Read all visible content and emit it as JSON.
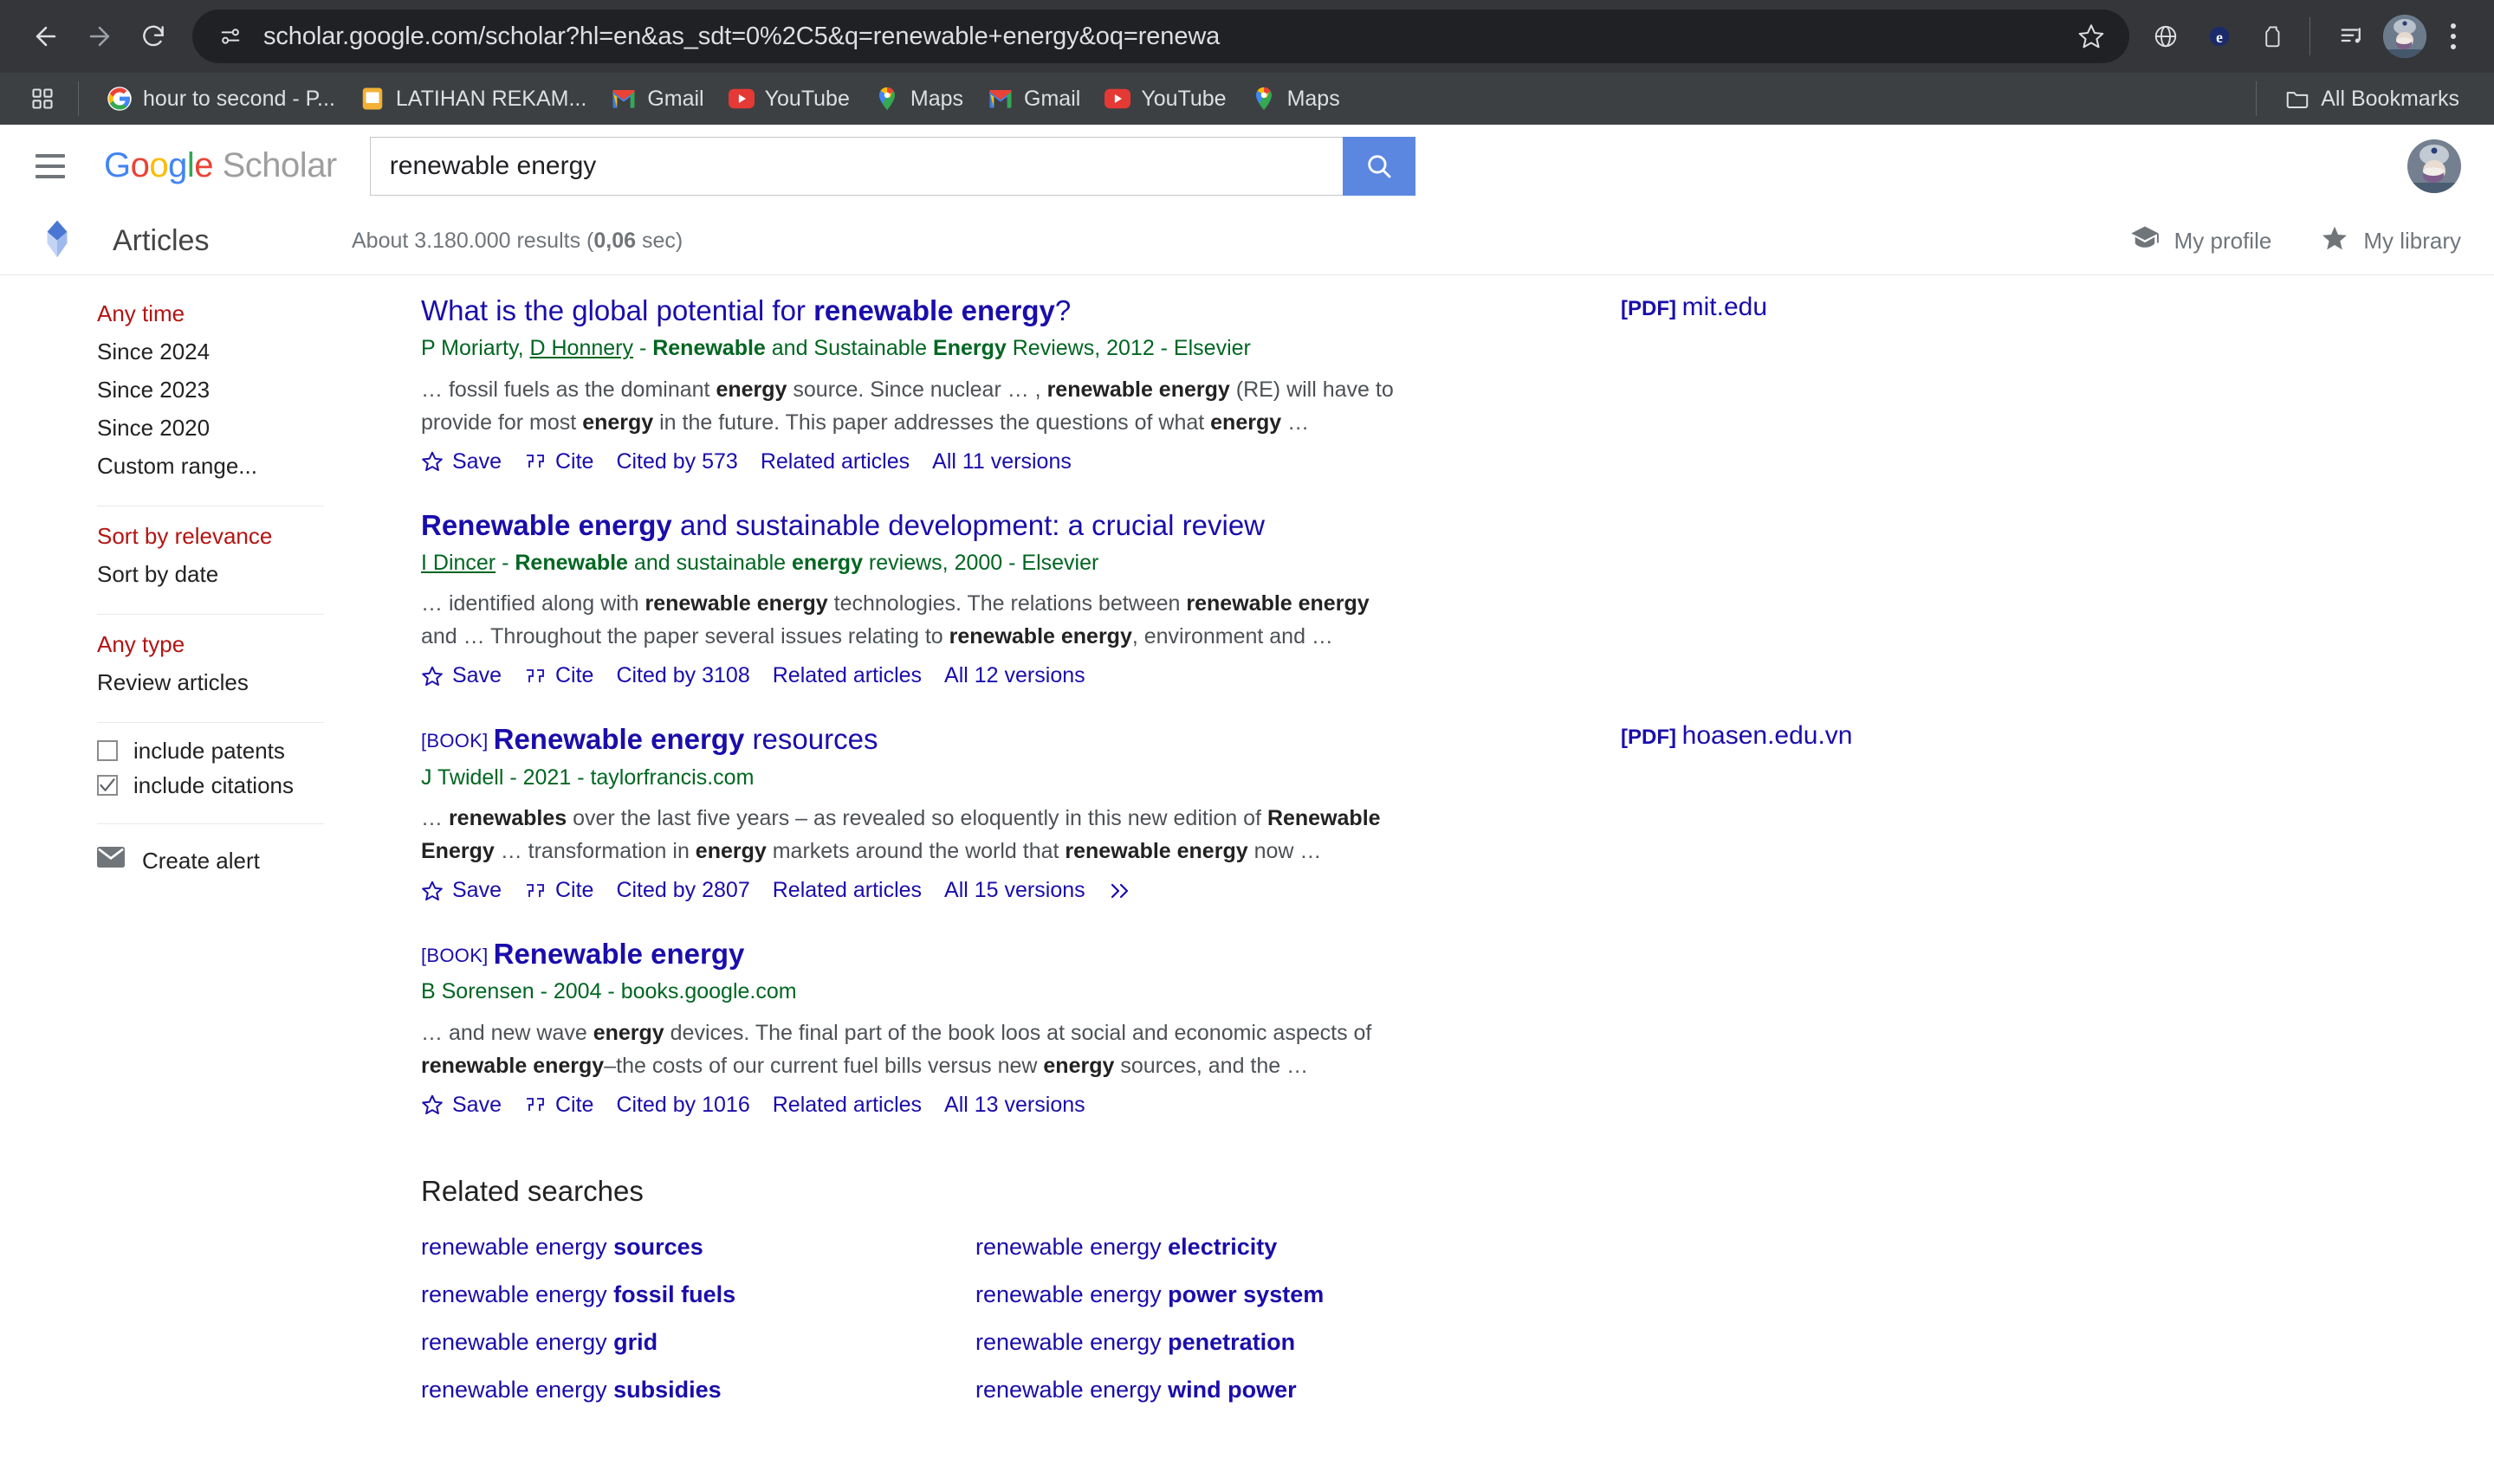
{
  "browser": {
    "url": "scholar.google.com/scholar?hl=en&as_sdt=0%2C5&q=renewable+energy&oq=renewa",
    "back_label": "Back",
    "forward_label": "Forward",
    "reload_label": "Reload",
    "site_info_label": "View site information",
    "bookmark_star_label": "Bookmark this tab",
    "toolbar_icons": [
      "globe-icon",
      "extension-puzzle-icon",
      "extension-icon",
      "reading-list-icon"
    ],
    "profile_label": "Profile",
    "menu_label": "Customize and control Google Chrome"
  },
  "bookmarks": {
    "apps_label": "Apps",
    "items": [
      {
        "label": "hour to second - P...",
        "icon": "google-favicon"
      },
      {
        "label": "LATIHAN REKAM...",
        "icon": "sheet-favicon"
      },
      {
        "label": "Gmail",
        "icon": "gmail-favicon"
      },
      {
        "label": "YouTube",
        "icon": "youtube-favicon"
      },
      {
        "label": "Maps",
        "icon": "maps-favicon"
      },
      {
        "label": "Gmail",
        "icon": "gmail-favicon"
      },
      {
        "label": "YouTube",
        "icon": "youtube-favicon"
      },
      {
        "label": "Maps",
        "icon": "maps-favicon"
      }
    ],
    "all_bookmarks_label": "All Bookmarks"
  },
  "scholar_header": {
    "menu_label": "Menu",
    "logo": {
      "g1": "G",
      "o1": "o",
      "o2": "o",
      "g2": "g",
      "l1": "l",
      "e1": "e",
      "scholar": " Scholar"
    },
    "search_value": "renewable energy",
    "search_placeholder": "Search",
    "search_button_label": "Search",
    "avatar_label": "Google Account"
  },
  "sub_header": {
    "section_icon": "scholar-articles-icon",
    "section_label": "Articles",
    "results_text_prefix": "About 3.180.000 results (",
    "results_time": "0,06",
    "results_text_suffix": " sec)",
    "my_profile_label": "My profile",
    "my_library_label": "My library"
  },
  "sidebar": {
    "time_group": [
      {
        "label": "Any time",
        "active": true
      },
      {
        "label": "Since 2024",
        "active": false
      },
      {
        "label": "Since 2023",
        "active": false
      },
      {
        "label": "Since 2020",
        "active": false
      },
      {
        "label": "Custom range...",
        "active": false
      }
    ],
    "sort_group": [
      {
        "label": "Sort by relevance",
        "active": true
      },
      {
        "label": "Sort by date",
        "active": false
      }
    ],
    "type_group": [
      {
        "label": "Any type",
        "active": true
      },
      {
        "label": "Review articles",
        "active": false
      }
    ],
    "checkboxes": [
      {
        "label": "include patents",
        "checked": false
      },
      {
        "label": "include citations",
        "checked": true
      }
    ],
    "create_alert_label": "Create alert"
  },
  "results": [
    {
      "tag": "",
      "title_plain_1": "What is the global potential for ",
      "title_bold": "renewable energy",
      "title_plain_2": "?",
      "meta_html": "P Moriarty, <u>D Honnery</u> - <b>Renewable</b> and Sustainable <b>Energy</b> Reviews, 2012 - Elsevier",
      "snippet_html": "… fossil fuels as the dominant <b>energy</b> source. Since nuclear … , <b>renewable energy</b> (RE) will have to provide for most <b>energy</b> in the future. This paper addresses the questions of what <b>energy</b> …",
      "save_label": "Save",
      "cite_label": "Cite",
      "cited_by_label": "Cited by 573",
      "related_label": "Related articles",
      "versions_label": "All 11 versions",
      "has_more": false,
      "pdf_prefix": "[PDF] ",
      "pdf_domain": "mit.edu"
    },
    {
      "tag": "",
      "title_bold_first": "Renewable energy",
      "title_plain_after": " and sustainable development: a crucial review",
      "meta_html": "<u>I Dincer</u> - <b>Renewable</b> and sustainable <b>energy</b> reviews, 2000 - Elsevier",
      "snippet_html": "… identified along with <b>renewable energy</b> technologies. The relations between <b>renewable energy</b> and … Throughout the paper several issues relating to <b>renewable energy</b>, environment and …",
      "save_label": "Save",
      "cite_label": "Cite",
      "cited_by_label": "Cited by 3108",
      "related_label": "Related articles",
      "versions_label": "All 12 versions",
      "has_more": false,
      "pdf_prefix": "",
      "pdf_domain": ""
    },
    {
      "tag": "[BOOK]",
      "title_bold_first": "Renewable energy",
      "title_plain_after": " resources",
      "meta_html": "J Twidell - 2021 - taylorfrancis.com",
      "snippet_html": "… <b>renewables</b> over the last five years – as revealed so eloquently in this new edition of <b>Renewable Energy</b> … transformation in <b>energy</b> markets around the world that <b>renewable energy</b> now …",
      "save_label": "Save",
      "cite_label": "Cite",
      "cited_by_label": "Cited by 2807",
      "related_label": "Related articles",
      "versions_label": "All 15 versions",
      "has_more": true,
      "pdf_prefix": "[PDF] ",
      "pdf_domain": "hoasen.edu.vn"
    },
    {
      "tag": "[BOOK]",
      "title_bold_first": "Renewable energy",
      "title_plain_after": "",
      "meta_html": "B Sorensen - 2004 - books.google.com",
      "snippet_html": "… and new wave <b>energy</b> devices. The final part of the book loos at social and economic aspects of <b>renewable energy</b>–the costs of our current fuel bills versus new <b>energy</b> sources, and the …",
      "save_label": "Save",
      "cite_label": "Cite",
      "cited_by_label": "Cited by 1016",
      "related_label": "Related articles",
      "versions_label": "All 13 versions",
      "has_more": false,
      "pdf_prefix": "",
      "pdf_domain": ""
    }
  ],
  "related_searches": {
    "title": "Related searches",
    "items": [
      {
        "plain": "renewable energy ",
        "bold": "sources"
      },
      {
        "plain": "renewable energy ",
        "bold": "electricity"
      },
      {
        "plain": "renewable energy ",
        "bold": "fossil fuels"
      },
      {
        "plain": "renewable energy ",
        "bold": "power system"
      },
      {
        "plain": "renewable energy ",
        "bold": "grid"
      },
      {
        "plain": "renewable energy ",
        "bold": "penetration"
      },
      {
        "plain": "renewable energy ",
        "bold": "subsidies"
      },
      {
        "plain": "renewable energy ",
        "bold": "wind power"
      }
    ]
  },
  "colors": {
    "link": "#1a0dab",
    "meta_green": "#006621",
    "accent_red": "#b31412",
    "search_button": "#5b87e0",
    "chrome_bg": "#35363a",
    "bookmarks_bg": "#3c4043"
  }
}
